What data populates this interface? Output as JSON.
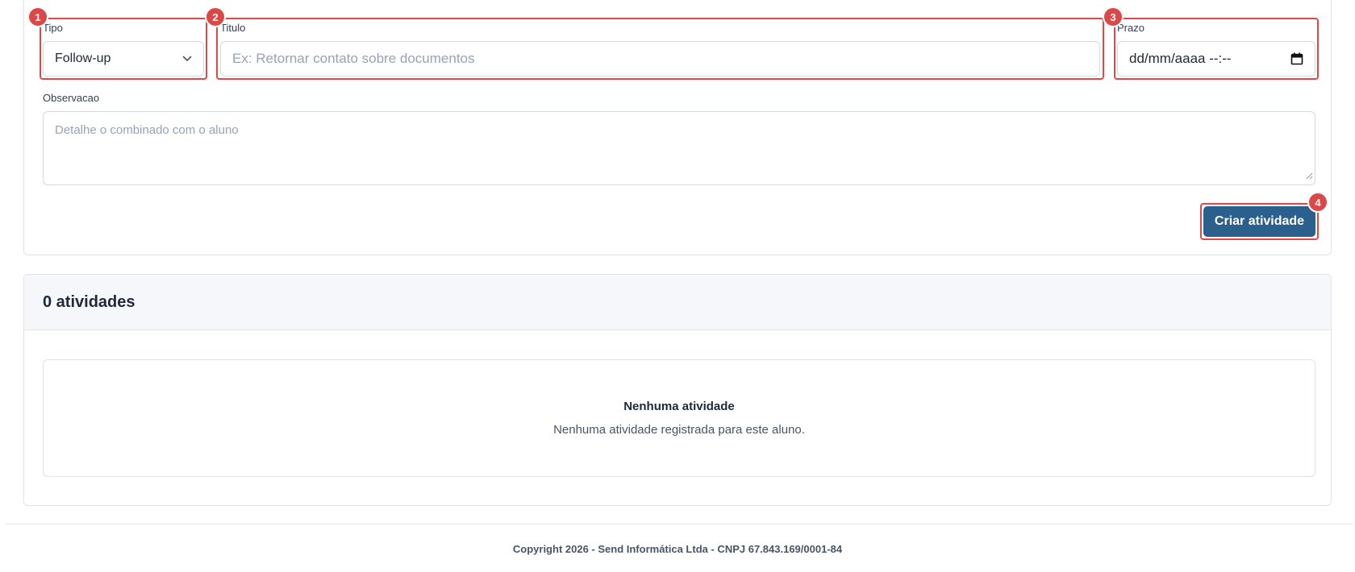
{
  "form": {
    "tipo": {
      "label": "Tipo",
      "value": "Follow-up"
    },
    "titulo": {
      "label": "Titulo",
      "placeholder": "Ex: Retornar contato sobre documentos"
    },
    "prazo": {
      "label": "Prazo",
      "value": "dd/mm/aaaa --:--"
    },
    "observacao": {
      "label": "Observacao",
      "placeholder": "Detalhe o combinado com o aluno"
    },
    "submit_label": "Criar atividade"
  },
  "annotations": [
    "1",
    "2",
    "3",
    "4"
  ],
  "activities": {
    "count_title": "0 atividades",
    "empty_title": "Nenhuma atividade",
    "empty_message": "Nenhuma atividade registrada para este aluno."
  },
  "footer": {
    "copyright": "Copyright 2026 - Send Informática Ltda - CNPJ 67.843.169/0001-84"
  },
  "colors": {
    "primary": "#2b5f8c",
    "highlight": "#e04848"
  }
}
